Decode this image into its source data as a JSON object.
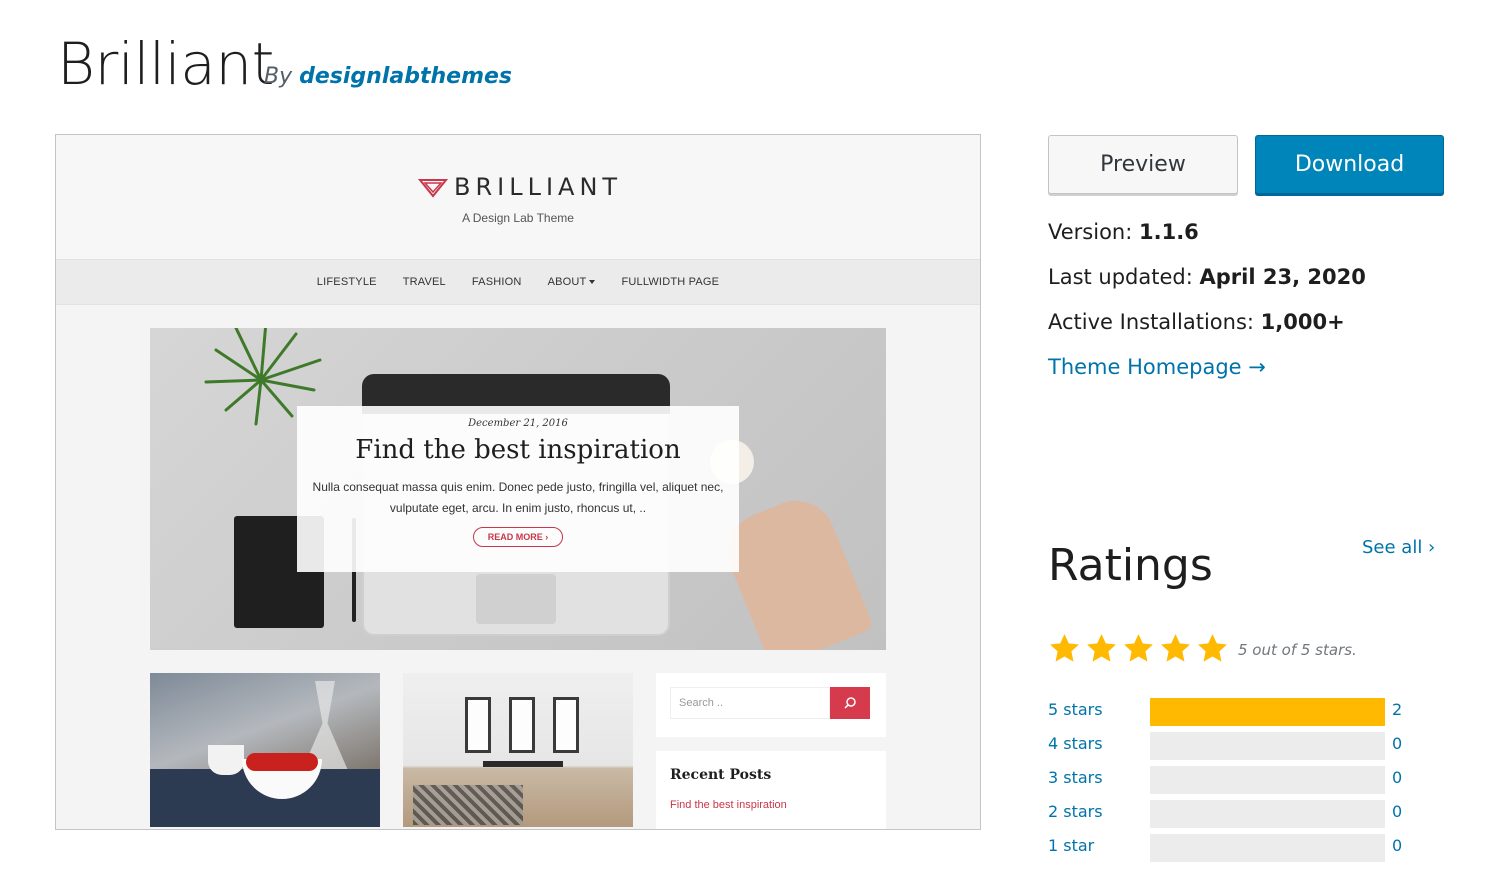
{
  "header": {
    "title": "Brilliant",
    "by": "By",
    "author": "designlabthemes"
  },
  "preview_site": {
    "logo": "BRILLIANT",
    "tagline": "A Design Lab Theme",
    "nav": [
      "LIFESTYLE",
      "TRAVEL",
      "FASHION",
      "ABOUT",
      "FULLWIDTH PAGE"
    ],
    "hero": {
      "date": "December 21, 2016",
      "headline": "Find the best inspiration",
      "excerpt": "Nulla consequat massa quis enim. Donec pede justo, fringilla vel, aliquet nec, vulputate eget, arcu. In enim justo, rhoncus ut, ..",
      "read_more": "READ MORE ›"
    },
    "search_placeholder": "Search ..",
    "recent_posts_title": "Recent Posts",
    "recent_post_link": "Find the best inspiration"
  },
  "actions": {
    "preview_label": "Preview",
    "download_label": "Download"
  },
  "meta": {
    "version_label": "Version:",
    "version_value": "1.1.6",
    "updated_label": "Last updated:",
    "updated_value": "April 23, 2020",
    "installs_label": "Active Installations:",
    "installs_value": "1,000+",
    "homepage_link": "Theme Homepage →"
  },
  "ratings": {
    "title": "Ratings",
    "see_all": "See all ›",
    "stars_filled": 5,
    "summary": "5 out of 5 stars.",
    "rows": [
      {
        "label": "5 stars",
        "count": "2",
        "fraction": 1.0
      },
      {
        "label": "4 stars",
        "count": "0",
        "fraction": 0
      },
      {
        "label": "3 stars",
        "count": "0",
        "fraction": 0
      },
      {
        "label": "2 stars",
        "count": "0",
        "fraction": 0
      },
      {
        "label": "1 star",
        "count": "0",
        "fraction": 0
      }
    ]
  },
  "colors": {
    "link": "#0073aa",
    "download_bg": "#0085ba",
    "star": "#ffb900",
    "accent_red": "#d63a4d"
  }
}
